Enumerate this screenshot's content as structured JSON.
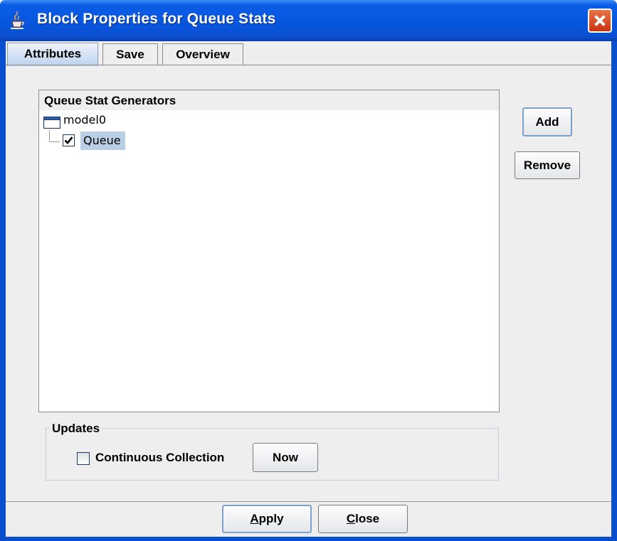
{
  "window": {
    "title": "Block Properties for Queue Stats",
    "icon": "java-cup-icon",
    "close_icon": "close-icon"
  },
  "tabs": [
    {
      "label": "Attributes",
      "selected": true
    },
    {
      "label": "Save",
      "selected": false
    },
    {
      "label": "Overview",
      "selected": false
    }
  ],
  "generators": {
    "title": "Queue Stat Generators",
    "tree": {
      "root": {
        "label": "model0",
        "icon": "folder-icon"
      },
      "children": [
        {
          "label": "Queue",
          "checked": true,
          "selected": true
        }
      ]
    },
    "add_label": "Add",
    "remove_label": "Remove"
  },
  "updates": {
    "title": "Updates",
    "continuous_label": "Continuous Collection",
    "continuous_checked": false,
    "now_label": "Now"
  },
  "footer": {
    "apply_label": "Apply",
    "apply_mnemonic": "A",
    "apply_rest": "pply",
    "close_label": "Close",
    "close_mnemonic": "C",
    "close_rest": "lose"
  },
  "colors": {
    "titlebar": "#0855dd",
    "selection": "#b8cfe5",
    "close_button": "#c83410"
  }
}
